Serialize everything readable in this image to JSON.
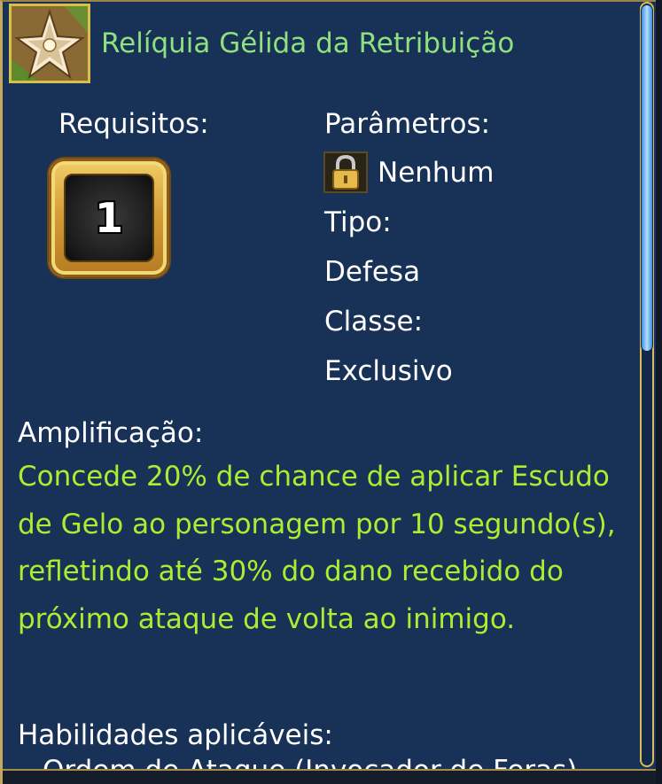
{
  "item": {
    "title": "Relíquia Gélida da Retribuição",
    "icon": "relic-star-icon"
  },
  "requirements": {
    "label": "Requisitos:",
    "level": "1"
  },
  "parameters": {
    "label": "Parâmetros:",
    "lock_icon": "lock-icon",
    "value": "Nenhum",
    "type_label": "Tipo:",
    "type_value": "Defesa",
    "class_label": "Classe:",
    "class_value": "Exclusivo"
  },
  "amplification": {
    "label": "Amplificação:",
    "description": "Concede 20% de chance de aplicar Escudo de Gelo ao personagem por 10 segundo(s), refletindo até 30% do dano recebido do próximo ataque de volta ao inimigo."
  },
  "skills": {
    "label": "Habilidades aplicáveis:",
    "items": [
      "Ordem de Ataque (Invocador de Feras)"
    ]
  },
  "colors": {
    "panel_bg": "#183257",
    "title_green": "#8fe07e",
    "description_green": "#a9ee32",
    "gold_border": "#d9bd5a",
    "scroll_thumb": "#5aa8f0"
  }
}
